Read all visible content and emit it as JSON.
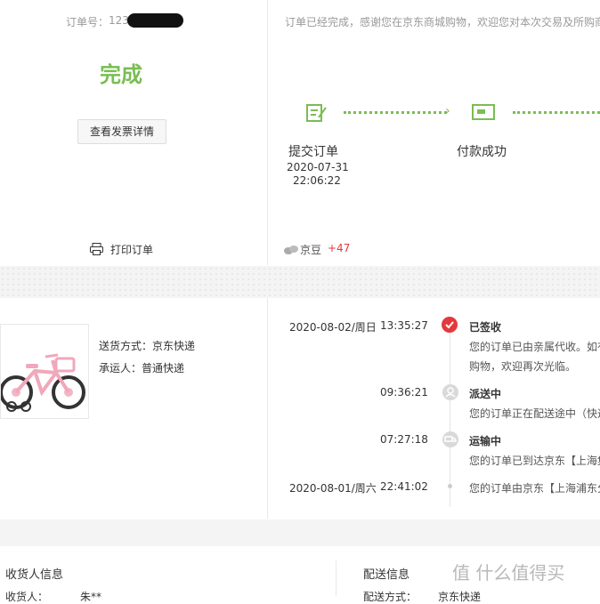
{
  "order": {
    "number_label": "订单号：",
    "number_prefix": "123",
    "status": "完成",
    "invoice_button": "查看发票详情",
    "print_label": "打印订单",
    "notice": "订单已经完成，感谢您在京东商城购物，欢迎您对本次交易及所购商品进行评价。"
  },
  "progress": {
    "steps": [
      {
        "label": "提交订单",
        "date": "2020-07-31",
        "time": "22:06:22"
      },
      {
        "label": "付款成功"
      }
    ],
    "jingdou_label": "京豆",
    "jingdou_value": "+47"
  },
  "shipment": {
    "delivery_label": "送货方式：京东快递",
    "carrier_label": "承运人：普通快递",
    "events": [
      {
        "date": "2020-08-02/周日",
        "time": "13:35:27",
        "status": "已签收",
        "desc_lines": [
          "您的订单已由亲属代收。如有疑问您可以联系配送员",
          "购物，欢迎再次光临。"
        ]
      },
      {
        "date": "",
        "time": "09:36:21",
        "status": "派送中",
        "desc_lines": [
          "您的订单正在配送途中（快递员：xxx，电话：xxx）"
        ]
      },
      {
        "date": "",
        "time": "07:27:18",
        "status": "运输中",
        "desc_lines": [
          "您的订单已到达京东【上海集货站】"
        ]
      },
      {
        "date": "2020-08-01/周六",
        "time": "22:41:02",
        "status": "",
        "desc_lines": [
          "您的订单由京东【上海浦东分拣中心】发出"
        ]
      }
    ]
  },
  "bottom": {
    "receiver_title": "收货人信息",
    "receiver_row": "收货人：",
    "receiver_value": "朱**",
    "delivery_title": "配送信息",
    "delivery_row": "配送方式：",
    "delivery_value": "京东快递"
  },
  "watermark": "值 什么值得买",
  "colors": {
    "accent_green": "#7abd54",
    "accent_red": "#e4393c"
  }
}
